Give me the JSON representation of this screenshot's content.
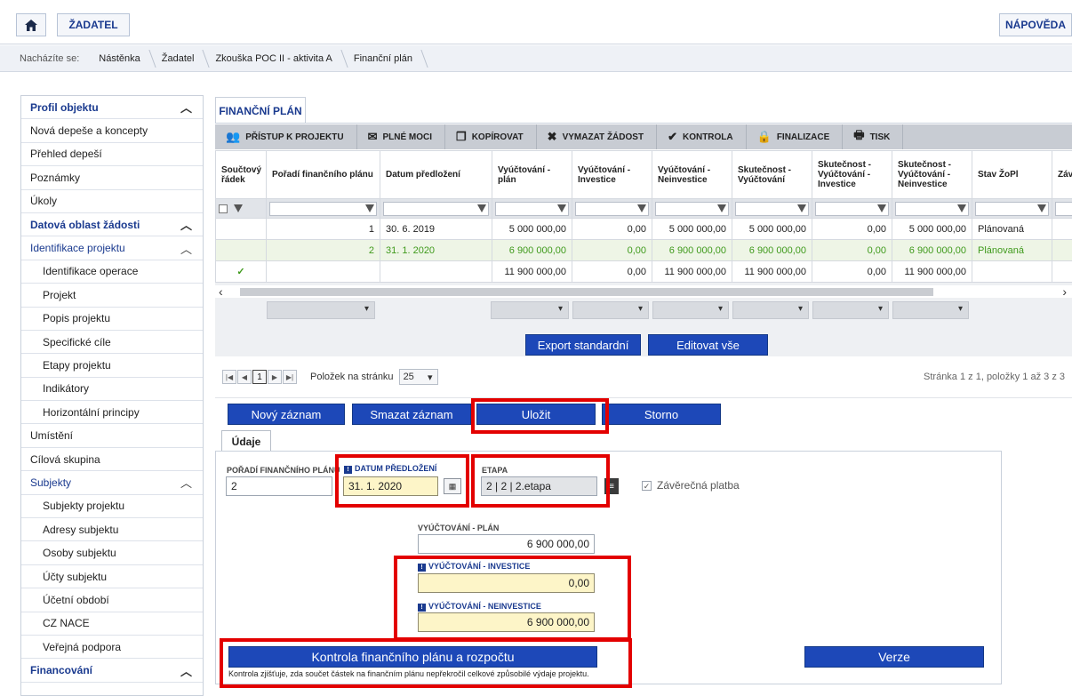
{
  "topbar": {
    "zadatel": "ŽADATEL",
    "napoveda": "NÁPOVĚDA"
  },
  "breadcrumb": {
    "label": "Nacházíte se:",
    "items": [
      "Nástěnka",
      "Žadatel",
      "Zkouška POC II - aktivita A",
      "Finanční plán"
    ]
  },
  "sidebar": {
    "items": [
      {
        "label": "Profil objektu",
        "type": "sec",
        "chevron": "︿"
      },
      {
        "label": "Nová depeše a koncepty",
        "type": "item"
      },
      {
        "label": "Přehled depeší",
        "type": "item"
      },
      {
        "label": "Poznámky",
        "type": "item"
      },
      {
        "label": "Úkoly",
        "type": "item"
      },
      {
        "label": "Datová oblast žádosti",
        "type": "sec",
        "chevron": "︿"
      },
      {
        "label": "Identifikace projektu",
        "type": "sub",
        "chevron": "︿"
      },
      {
        "label": "Identifikace operace",
        "type": "child"
      },
      {
        "label": "Projekt",
        "type": "child"
      },
      {
        "label": "Popis projektu",
        "type": "child"
      },
      {
        "label": "Specifické cíle",
        "type": "child"
      },
      {
        "label": "Etapy projektu",
        "type": "child"
      },
      {
        "label": "Indikátory",
        "type": "child"
      },
      {
        "label": "Horizontální principy",
        "type": "child"
      },
      {
        "label": "Umístění",
        "type": "item"
      },
      {
        "label": "Cílová skupina",
        "type": "item"
      },
      {
        "label": "Subjekty",
        "type": "sub",
        "chevron": "︿"
      },
      {
        "label": "Subjekty projektu",
        "type": "child"
      },
      {
        "label": "Adresy subjektu",
        "type": "child"
      },
      {
        "label": "Osoby subjektu",
        "type": "child"
      },
      {
        "label": "Účty subjektu",
        "type": "child"
      },
      {
        "label": "Účetní období",
        "type": "child"
      },
      {
        "label": "CZ NACE",
        "type": "child"
      },
      {
        "label": "Veřejná podpora",
        "type": "child"
      },
      {
        "label": "Financování",
        "type": "sec",
        "chevron": "︿"
      }
    ]
  },
  "main_tab": "FINANČNÍ PLÁN",
  "toolbar": {
    "pristup": "PŘÍSTUP K PROJEKTU",
    "plne_moci": "PLNÉ MOCI",
    "kopirovat": "KOPÍROVAT",
    "vymazat": "VYMAZAT ŽÁDOST",
    "kontrola": "KONTROLA",
    "finalizace": "FINALIZACE",
    "tisk": "TISK"
  },
  "grid": {
    "headers": [
      "Součtový řádek",
      "Pořadí finančního plánu",
      "Datum předložení",
      "Vyúčtování - plán",
      "Vyúčtování - Investice",
      "Vyúčtování - Neinvestice",
      "Skutečnost - Vyúčtování",
      "Skutečnost - Vyúčtování - Investice",
      "Skutečnost - Vyúčtování - Neinvestice",
      "Stav ŽoPl",
      "Závě"
    ],
    "rows": [
      [
        "",
        "1",
        "30. 6. 2019",
        "5 000 000,00",
        "0,00",
        "5 000 000,00",
        "5 000 000,00",
        "0,00",
        "5 000 000,00",
        "Plánovaná",
        ""
      ],
      [
        "",
        "2",
        "31. 1. 2020",
        "6 900 000,00",
        "0,00",
        "6 900 000,00",
        "6 900 000,00",
        "0,00",
        "6 900 000,00",
        "Plánovaná",
        ""
      ],
      [
        "✓",
        "",
        "",
        "11 900 000,00",
        "0,00",
        "11 900 000,00",
        "11 900 000,00",
        "0,00",
        "11 900 000,00",
        "",
        ""
      ]
    ]
  },
  "buttons": {
    "export": "Export standardní",
    "editovat": "Editovat vše",
    "novy": "Nový záznam",
    "smazat": "Smazat záznam",
    "ulozit": "Uložit",
    "storno": "Storno",
    "kontrola_fp": "Kontrola finančního plánu a rozpočtu",
    "verze": "Verze"
  },
  "pager": {
    "page": "1",
    "per_page_label": "Položek na stránku",
    "per_page": "25",
    "summary": "Stránka 1 z 1, položky 1 až 3 z 3"
  },
  "form": {
    "tab": "Údaje",
    "poradi_label": "POŘADÍ FINANČNÍHO PLÁNU",
    "poradi_value": "2",
    "datum_label": "DATUM PŘEDLOŽENÍ",
    "datum_value": "31. 1. 2020",
    "etapa_label": "ETAPA",
    "etapa_value": "2 | 2 | 2.etapa",
    "zaverecna": "Závěrečná platba",
    "plan_label": "VYÚČTOVÁNÍ - PLÁN",
    "plan_value": "6 900 000,00",
    "investice_label": "VYÚČTOVÁNÍ - INVESTICE",
    "investice_value": "0,00",
    "neinvestice_label": "VYÚČTOVÁNÍ - NEINVESTICE",
    "neinvestice_value": "6 900 000,00",
    "note": "Kontrola zjišťuje, zda součet částek na finančním plánu nepřekročil celkové způsobilé výdaje projektu."
  },
  "colors": {
    "accent": "#1d48b8",
    "highlight": "#e30000",
    "success": "#3f9a1c"
  }
}
